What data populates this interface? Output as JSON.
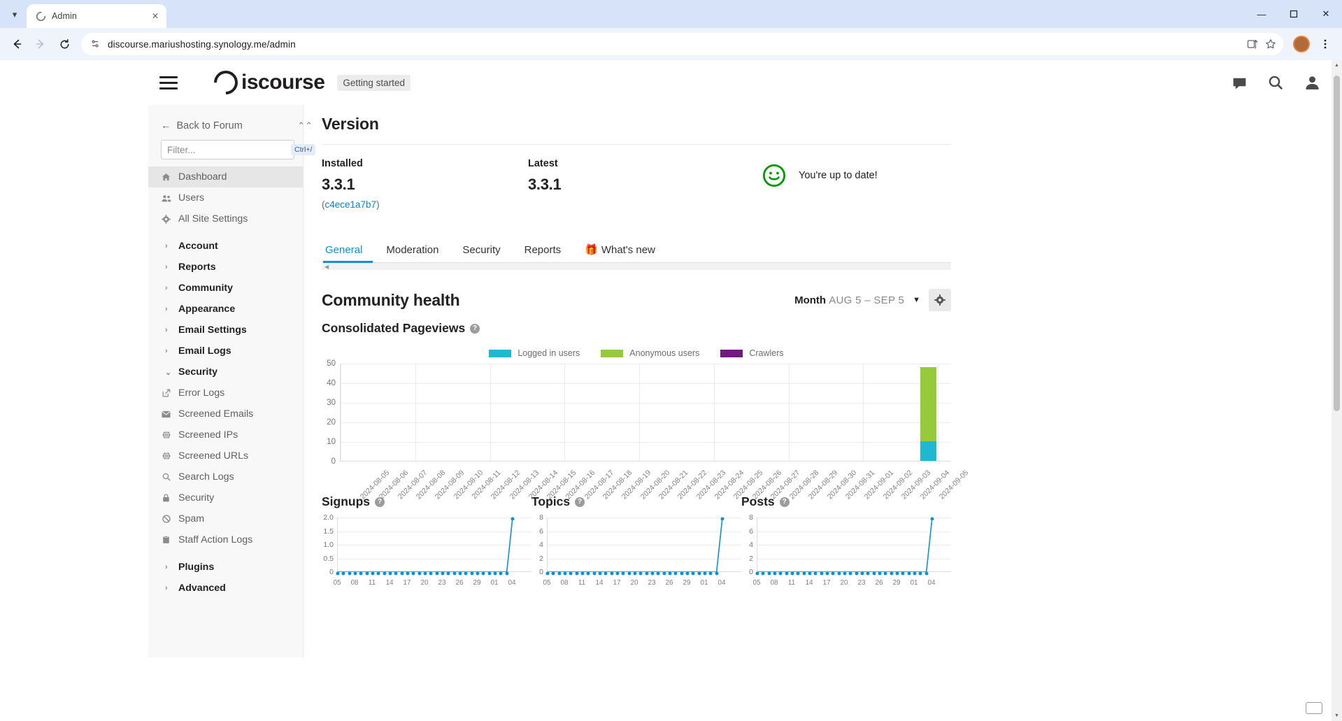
{
  "browser": {
    "tab": {
      "title": "Admin",
      "favicon_icon": "discourse-favicon",
      "close_icon": "close-icon"
    },
    "tab_list_chevron_icon": "chevron-down-icon",
    "back_icon": "arrow-left-icon",
    "forward_icon": "arrow-right-icon",
    "reload_icon": "reload-icon",
    "site_info_icon": "site-settings-icon",
    "url": "discourse.mariushosting.synology.me/admin",
    "install_icon": "install-app-icon",
    "bookmark_icon": "star-icon",
    "menu_icon": "kebab-menu-icon",
    "profile_initial": "",
    "window_minimize": "—",
    "window_maximize": "❑",
    "window_close": "✕"
  },
  "header": {
    "hamburger_icon": "hamburger-menu-icon",
    "logo_text": "iscourse",
    "getting_started": "Getting started",
    "chat_icon": "chat-bubble-icon",
    "search_icon": "search-icon",
    "user_icon": "user-avatar-icon"
  },
  "sidebar": {
    "back_label": "Back to Forum",
    "back_icon": "arrow-left-icon",
    "collapse_icon": "chevrons-up-icon",
    "filter": {
      "placeholder": "Filter...",
      "value": "",
      "shortcut": "Ctrl+/"
    },
    "primary": [
      {
        "label": "Dashboard",
        "icon": "home-icon",
        "active": true
      },
      {
        "label": "Users",
        "icon": "users-icon",
        "active": false
      },
      {
        "label": "All Site Settings",
        "icon": "gear-icon",
        "active": false
      }
    ],
    "sections": [
      {
        "label": "Account",
        "expanded": false
      },
      {
        "label": "Reports",
        "expanded": false
      },
      {
        "label": "Community",
        "expanded": false
      },
      {
        "label": "Appearance",
        "expanded": false
      },
      {
        "label": "Email Settings",
        "expanded": false
      },
      {
        "label": "Email Logs",
        "expanded": false
      },
      {
        "label": "Security",
        "expanded": true
      }
    ],
    "security_items": [
      {
        "label": "Error Logs",
        "icon": "external-link-icon"
      },
      {
        "label": "Screened Emails",
        "icon": "envelope-icon"
      },
      {
        "label": "Screened IPs",
        "icon": "globe-icon"
      },
      {
        "label": "Screened URLs",
        "icon": "globe-icon"
      },
      {
        "label": "Search Logs",
        "icon": "search-icon"
      },
      {
        "label": "Security",
        "icon": "lock-icon"
      },
      {
        "label": "Spam",
        "icon": "ban-icon"
      },
      {
        "label": "Staff Action Logs",
        "icon": "clipboard-icon"
      }
    ],
    "tail_sections": [
      {
        "label": "Plugins",
        "expanded": false
      },
      {
        "label": "Advanced",
        "expanded": false
      }
    ]
  },
  "version": {
    "heading": "Version",
    "installed_label": "Installed",
    "installed_value": "3.3.1",
    "installed_hash": "c4ece1a7b7",
    "latest_label": "Latest",
    "latest_value": "3.3.1",
    "status_text": "You're up to date!",
    "status_icon": "smiley-face-icon",
    "status_color": "#009900"
  },
  "tabs": [
    {
      "label": "General",
      "selected": true,
      "emoji": ""
    },
    {
      "label": "Moderation",
      "selected": false,
      "emoji": ""
    },
    {
      "label": "Security",
      "selected": false,
      "emoji": ""
    },
    {
      "label": "Reports",
      "selected": false,
      "emoji": ""
    },
    {
      "label": "What's new",
      "selected": false,
      "emoji": "🎁"
    }
  ],
  "community_health": {
    "heading": "Community health",
    "period_unit": "Month",
    "period_range": "AUG 5 – SEP 5",
    "caret_icon": "chevron-down-icon",
    "gear_icon": "gear-icon",
    "help_glyph": "?"
  },
  "chart_data": [
    {
      "type": "bar",
      "title": "Consolidated Pageviews",
      "stacked": true,
      "xlabel": "",
      "ylabel": "",
      "ylim": [
        0,
        50
      ],
      "yticks": [
        0,
        10,
        20,
        30,
        40,
        50
      ],
      "grid": true,
      "legend_position": "top-center",
      "categories": [
        "2024-08-05",
        "2024-08-06",
        "2024-08-07",
        "2024-08-08",
        "2024-08-09",
        "2024-08-10",
        "2024-08-11",
        "2024-08-12",
        "2024-08-13",
        "2024-08-14",
        "2024-08-15",
        "2024-08-16",
        "2024-08-17",
        "2024-08-18",
        "2024-08-19",
        "2024-08-20",
        "2024-08-21",
        "2024-08-22",
        "2024-08-23",
        "2024-08-24",
        "2024-08-25",
        "2024-08-26",
        "2024-08-27",
        "2024-08-28",
        "2024-08-29",
        "2024-08-30",
        "2024-08-31",
        "2024-09-01",
        "2024-09-02",
        "2024-09-03",
        "2024-09-04",
        "2024-09-05"
      ],
      "series": [
        {
          "name": "Logged in users",
          "color": "#1eb8d0",
          "values": [
            0,
            0,
            0,
            0,
            0,
            0,
            0,
            0,
            0,
            0,
            0,
            0,
            0,
            0,
            0,
            0,
            0,
            0,
            0,
            0,
            0,
            0,
            0,
            0,
            0,
            0,
            0,
            0,
            0,
            0,
            0,
            10
          ]
        },
        {
          "name": "Anonymous users",
          "color": "#97c93d",
          "values": [
            0,
            0,
            0,
            0,
            0,
            0,
            0,
            0,
            0,
            0,
            0,
            0,
            0,
            0,
            0,
            0,
            0,
            0,
            0,
            0,
            0,
            0,
            0,
            0,
            0,
            0,
            0,
            0,
            0,
            0,
            0,
            38
          ]
        },
        {
          "name": "Crawlers",
          "color": "#6f1b7f",
          "values": [
            0,
            0,
            0,
            0,
            0,
            0,
            0,
            0,
            0,
            0,
            0,
            0,
            0,
            0,
            0,
            0,
            0,
            0,
            0,
            0,
            0,
            0,
            0,
            0,
            0,
            0,
            0,
            0,
            0,
            0,
            0,
            0
          ]
        }
      ]
    },
    {
      "type": "line",
      "title": "Signups",
      "color": "#0b91d6",
      "ylim": [
        0,
        2.0
      ],
      "yticks": [
        "0",
        "0.5",
        "1.0",
        "1.5",
        "2.0"
      ],
      "xticks": [
        "05",
        "08",
        "11",
        "14",
        "17",
        "20",
        "23",
        "26",
        "29",
        "01",
        "04"
      ],
      "x": [
        "2024-08-05",
        "2024-09-04"
      ],
      "values": [
        0,
        0,
        0,
        0,
        0,
        0,
        0,
        0,
        0,
        0,
        0,
        0,
        0,
        0,
        0,
        0,
        0,
        0,
        0,
        0,
        0,
        0,
        0,
        0,
        0,
        0,
        0,
        0,
        0,
        0,
        2.0
      ]
    },
    {
      "type": "line",
      "title": "Topics",
      "color": "#0b91d6",
      "ylim": [
        0,
        8
      ],
      "yticks": [
        "0",
        "2",
        "4",
        "6",
        "8"
      ],
      "xticks": [
        "05",
        "08",
        "11",
        "14",
        "17",
        "20",
        "23",
        "26",
        "29",
        "01",
        "04"
      ],
      "x": [
        "2024-08-05",
        "2024-09-04"
      ],
      "values": [
        0,
        0,
        0,
        0,
        0,
        0,
        0,
        0,
        0,
        0,
        0,
        0,
        0,
        0,
        0,
        0,
        0,
        0,
        0,
        0,
        0,
        0,
        0,
        0,
        0,
        0,
        0,
        0,
        0,
        0,
        8
      ]
    },
    {
      "type": "line",
      "title": "Posts",
      "color": "#0b91d6",
      "ylim": [
        0,
        8
      ],
      "yticks": [
        "0",
        "2",
        "4",
        "6",
        "8"
      ],
      "xticks": [
        "05",
        "08",
        "11",
        "14",
        "17",
        "20",
        "23",
        "26",
        "29",
        "01",
        "04"
      ],
      "x": [
        "2024-08-05",
        "2024-09-04"
      ],
      "values": [
        0,
        0,
        0,
        0,
        0,
        0,
        0,
        0,
        0,
        0,
        0,
        0,
        0,
        0,
        0,
        0,
        0,
        0,
        0,
        0,
        0,
        0,
        0,
        0,
        0,
        0,
        0,
        0,
        0,
        0,
        8
      ]
    }
  ]
}
